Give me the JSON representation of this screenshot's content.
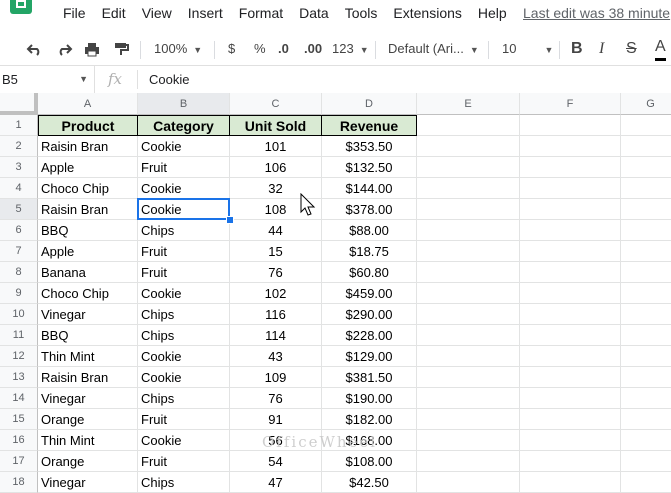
{
  "menu": [
    "File",
    "Edit",
    "View",
    "Insert",
    "Format",
    "Data",
    "Tools",
    "Extensions",
    "Help"
  ],
  "last_edit": "Last edit was 38 minute",
  "toolbar": {
    "zoom": "100%",
    "currency": "$",
    "percent": "%",
    "dec_decrease": ".0",
    "dec_increase": ".00",
    "more_formats": "123",
    "font": "Default (Ari...",
    "font_size": "10",
    "bold": "B",
    "italic": "I",
    "strike": "S",
    "text_color": "A"
  },
  "formula_bar": {
    "name_box": "B5",
    "fx": "fx",
    "value": "Cookie"
  },
  "columns": [
    "A",
    "B",
    "C",
    "D",
    "E",
    "F",
    "G"
  ],
  "header": [
    "Product",
    "Category",
    "Unit Sold",
    "Revenue"
  ],
  "rows": [
    [
      "Raisin Bran",
      "Cookie",
      "101",
      "$353.50"
    ],
    [
      "Apple",
      "Fruit",
      "106",
      "$132.50"
    ],
    [
      "Choco Chip",
      "Cookie",
      "32",
      "$144.00"
    ],
    [
      "Raisin Bran",
      "Cookie",
      "108",
      "$378.00"
    ],
    [
      "BBQ",
      "Chips",
      "44",
      "$88.00"
    ],
    [
      "Apple",
      "Fruit",
      "15",
      "$18.75"
    ],
    [
      "Banana",
      "Fruit",
      "76",
      "$60.80"
    ],
    [
      "Choco Chip",
      "Cookie",
      "102",
      "$459.00"
    ],
    [
      "Vinegar",
      "Chips",
      "116",
      "$290.00"
    ],
    [
      "BBQ",
      "Chips",
      "114",
      "$228.00"
    ],
    [
      "Thin Mint",
      "Cookie",
      "43",
      "$129.00"
    ],
    [
      "Raisin Bran",
      "Cookie",
      "109",
      "$381.50"
    ],
    [
      "Vinegar",
      "Chips",
      "76",
      "$190.00"
    ],
    [
      "Orange",
      "Fruit",
      "91",
      "$182.00"
    ],
    [
      "Thin Mint",
      "Cookie",
      "56",
      "$168.00"
    ],
    [
      "Orange",
      "Fruit",
      "54",
      "$108.00"
    ],
    [
      "Vinegar",
      "Chips",
      "47",
      "$42.50"
    ]
  ],
  "row_numbers": [
    "1",
    "2",
    "3",
    "4",
    "5",
    "6",
    "7",
    "8",
    "9",
    "10",
    "11",
    "12",
    "13",
    "14",
    "15",
    "16",
    "17",
    "18"
  ],
  "selected_cell": "B5",
  "watermark": "OfficeWheel",
  "colors": {
    "header_fill": "#d9ead3",
    "selection": "#1a73e8",
    "logo": "#23a566"
  }
}
